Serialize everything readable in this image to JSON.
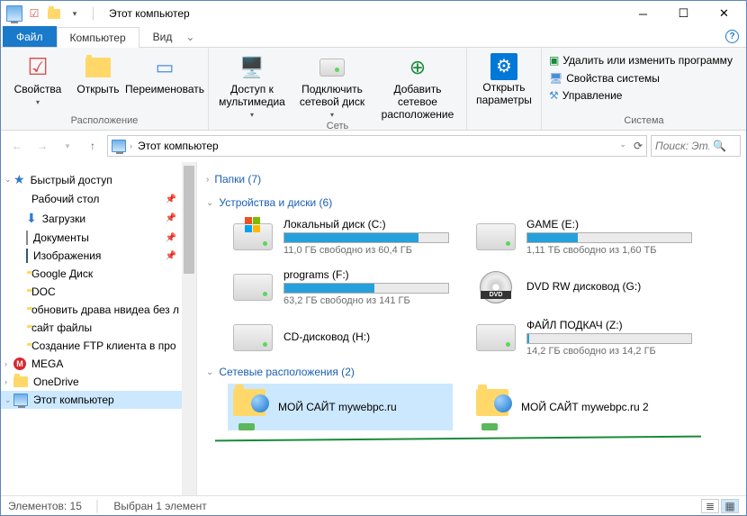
{
  "window": {
    "title": "Этот компьютер"
  },
  "tabs": {
    "file": "Файл",
    "computer": "Компьютер",
    "view": "Вид"
  },
  "ribbon": {
    "group1": {
      "label": "Расположение",
      "properties": "Свойства",
      "open": "Открыть",
      "rename": "Переименовать"
    },
    "group2": {
      "label": "Сеть",
      "media": "Доступ к мультимедиа",
      "mapdrive": "Подключить сетевой диск",
      "addnet": "Добавить сетевое расположение"
    },
    "group3": {
      "label": "",
      "settings": "Открыть параметры"
    },
    "group4": {
      "label": "Система",
      "uninstall": "Удалить или изменить программу",
      "sysprops": "Свойства системы",
      "manage": "Управление"
    }
  },
  "address": {
    "location": "Этот компьютер"
  },
  "search": {
    "placeholder": "Поиск: Эт..."
  },
  "sidebar": {
    "quick": "Быстрый доступ",
    "items": [
      "Рабочий стол",
      "Загрузки",
      "Документы",
      "Изображения",
      "Google Диск",
      "DOC",
      "обновить драва нвидеа без л",
      "сайт файлы",
      "Создание FTP клиента в про"
    ],
    "mega": "MEGA",
    "onedrive": "OneDrive",
    "thispc": "Этот компьютер"
  },
  "sections": {
    "folders": {
      "title": "Папки",
      "count": 7
    },
    "devices": {
      "title": "Устройства и диски",
      "count": 6
    },
    "network": {
      "title": "Сетевые расположения",
      "count": 2
    }
  },
  "drives": [
    {
      "name": "Локальный диск (C:)",
      "free": "11,0 ГБ свободно из 60,4 ГБ",
      "pct": 82,
      "type": "hdd",
      "win": true
    },
    {
      "name": "GAME (E:)",
      "free": "1,11 ТБ свободно из 1,60 ТБ",
      "pct": 31,
      "type": "hdd"
    },
    {
      "name": "programs (F:)",
      "free": "63,2 ГБ свободно из 141 ГБ",
      "pct": 55,
      "type": "hdd"
    },
    {
      "name": "DVD RW дисковод (G:)",
      "free": "",
      "pct": -1,
      "type": "dvd"
    },
    {
      "name": "CD-дисковод (H:)",
      "free": "",
      "pct": -1,
      "type": "hdd"
    },
    {
      "name": "ФАЙЛ ПОДКАЧ (Z:)",
      "free": "14,2 ГБ свободно из 14,2 ГБ",
      "pct": 1,
      "type": "hdd"
    }
  ],
  "netlocs": [
    {
      "name": "МОЙ САЙТ mywebpc.ru",
      "selected": true
    },
    {
      "name": "МОЙ САЙТ mywebpc.ru 2",
      "selected": false
    }
  ],
  "status": {
    "items_label": "Элементов:",
    "items": 15,
    "sel_label": "Выбран 1 элемент"
  }
}
